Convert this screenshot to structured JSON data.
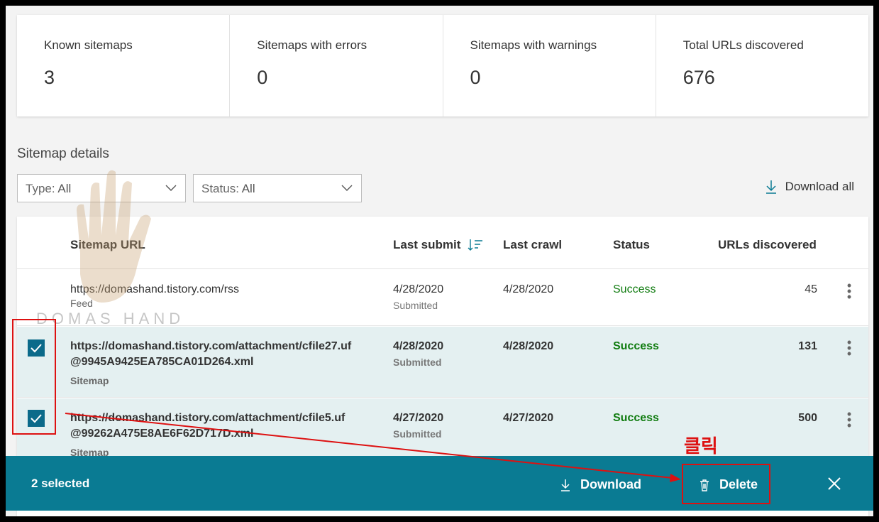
{
  "stats": [
    {
      "label": "Known sitemaps",
      "value": "3"
    },
    {
      "label": "Sitemaps with errors",
      "value": "0"
    },
    {
      "label": "Sitemaps with warnings",
      "value": "0"
    },
    {
      "label": "Total URLs discovered",
      "value": "676"
    }
  ],
  "section_title": "Sitemap details",
  "filters": {
    "type_label": "Type:",
    "type_value": "All",
    "status_label": "Status:",
    "status_value": "All"
  },
  "download_all_label": "Download all",
  "columns": {
    "url": "Sitemap URL",
    "last_submit": "Last submit",
    "last_crawl": "Last crawl",
    "status": "Status",
    "urls": "URLs discovered"
  },
  "rows": [
    {
      "url_line1": "https://domashand.tistory.com/rss",
      "url_line2": "",
      "kind": "Feed",
      "last_submit": "4/28/2020",
      "submit_note": "Submitted",
      "last_crawl": "4/28/2020",
      "status": "Success",
      "urls": "45",
      "selected": false
    },
    {
      "url_line1": "https://domashand.tistory.com/attachment/cfile27.uf",
      "url_line2": "@9945A9425EA785CA01D264.xml",
      "kind": "Sitemap",
      "last_submit": "4/28/2020",
      "submit_note": "Submitted",
      "last_crawl": "4/28/2020",
      "status": "Success",
      "urls": "131",
      "selected": true
    },
    {
      "url_line1": "https://domashand.tistory.com/attachment/cfile5.uf",
      "url_line2": "@99262A475E8AE6F62D717D.xml",
      "kind": "Sitemap",
      "last_submit": "4/27/2020",
      "submit_note": "Submitted",
      "last_crawl": "4/27/2020",
      "status": "Success",
      "urls": "500",
      "selected": true
    }
  ],
  "action_bar": {
    "selected_text": "2 selected",
    "download_label": "Download",
    "delete_label": "Delete"
  },
  "annotation": {
    "click_label": "클릭"
  },
  "watermark": {
    "text": "DOMAS HAND"
  },
  "colors": {
    "accent": "#0a7b93",
    "success": "#107c10",
    "selected_row": "#e4f0f1",
    "annotation": "#dd1111"
  }
}
